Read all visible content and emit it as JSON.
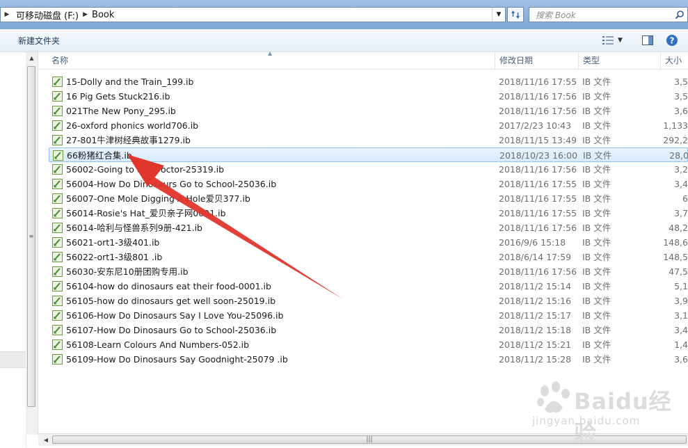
{
  "address": {
    "segments": [
      "可移动磁盘 (F:)",
      "Book"
    ]
  },
  "search": {
    "placeholder": "搜索 Book"
  },
  "toolbar": {
    "new_folder": "新建文件夹"
  },
  "columns": {
    "name": "名称",
    "date": "修改日期",
    "type": "类型",
    "size": "大小"
  },
  "files": [
    {
      "name": "15-Dolly and the Train_199.ib",
      "date": "2018/11/16 17:55",
      "type": "IB 文件",
      "size": "3,5"
    },
    {
      "name": "16 Pig Gets Stuck216.ib",
      "date": "2018/11/16 17:56",
      "type": "IB 文件",
      "size": "3,5"
    },
    {
      "name": "021The New Pony_295.ib",
      "date": "2018/11/16 17:56",
      "type": "IB 文件",
      "size": "3,6"
    },
    {
      "name": "26-oxford phonics world706.ib",
      "date": "2017/2/23 10:43",
      "type": "IB 文件",
      "size": "1,133"
    },
    {
      "name": "27-801牛津树经典故事1279.ib",
      "date": "2018/11/15 13:49",
      "type": "IB 文件",
      "size": "292,2"
    },
    {
      "name": "66粉猪红合集.ib",
      "date": "2018/10/23 16:00",
      "type": "IB 文件",
      "size": "28,0",
      "selected": true
    },
    {
      "name": "56002-Going to the Doctor-25319.ib",
      "date": "2018/11/16 17:56",
      "type": "IB 文件",
      "size": "3,2"
    },
    {
      "name": "56004-How Do Dinosaurs Go to School-25036.ib",
      "date": "2018/11/16 17:55",
      "type": "IB 文件",
      "size": "3,4"
    },
    {
      "name": "56007-One Mole Digging A Hole爱贝377.ib",
      "date": "2018/11/16 17:55",
      "type": "IB 文件",
      "size": "6"
    },
    {
      "name": "56014-Rosie's Hat_爱贝亲子网0001.ib",
      "date": "2018/11/16 17:55",
      "type": "IB 文件",
      "size": "3,7"
    },
    {
      "name": "56014-哈利与怪兽系列9册-421.ib",
      "date": "2018/11/16 17:56",
      "type": "IB 文件",
      "size": "48,2"
    },
    {
      "name": "56021-ort1-3级401.ib",
      "date": "2016/9/6 15:18",
      "type": "IB 文件",
      "size": "148,6"
    },
    {
      "name": "56022-ort1-3级801 .ib",
      "date": "2018/6/14 17:59",
      "type": "IB 文件",
      "size": "148,5"
    },
    {
      "name": "56030-安东尼10册团购专用.ib",
      "date": "2018/11/16 17:56",
      "type": "IB 文件",
      "size": "47,5"
    },
    {
      "name": "56104-how do dinosaurs eat their food-0001.ib",
      "date": "2018/11/2 15:14",
      "type": "IB 文件",
      "size": "5,1"
    },
    {
      "name": "56105-how do dinosaurs get well soon-25019.ib",
      "date": "2018/11/2 15:16",
      "type": "IB 文件",
      "size": "3,9"
    },
    {
      "name": "56106-How Do Dinosaurs Say I Love You-25096.ib",
      "date": "2018/11/2 15:17",
      "type": "IB 文件",
      "size": "3,1"
    },
    {
      "name": "56107-How Do Dinosaurs Go to School-25036.ib",
      "date": "2018/11/2 15:18",
      "type": "IB 文件",
      "size": "3,4"
    },
    {
      "name": "56108-Learn Colours And Numbers-052.ib",
      "date": "2018/11/2 15:21",
      "type": "IB 文件",
      "size": "1,4"
    },
    {
      "name": "56109-How Do Dinosaurs Say Goodnight-25079 .ib",
      "date": "2018/11/2 15:28",
      "type": "IB 文件",
      "size": "3,6"
    }
  ],
  "watermark": {
    "logo": "Baidu经验",
    "url": "jingyan.baidu.com"
  },
  "colors": {
    "selection": "#d7eafc",
    "annotation_arrow": "#e0362c",
    "header_text": "#4c607a"
  }
}
